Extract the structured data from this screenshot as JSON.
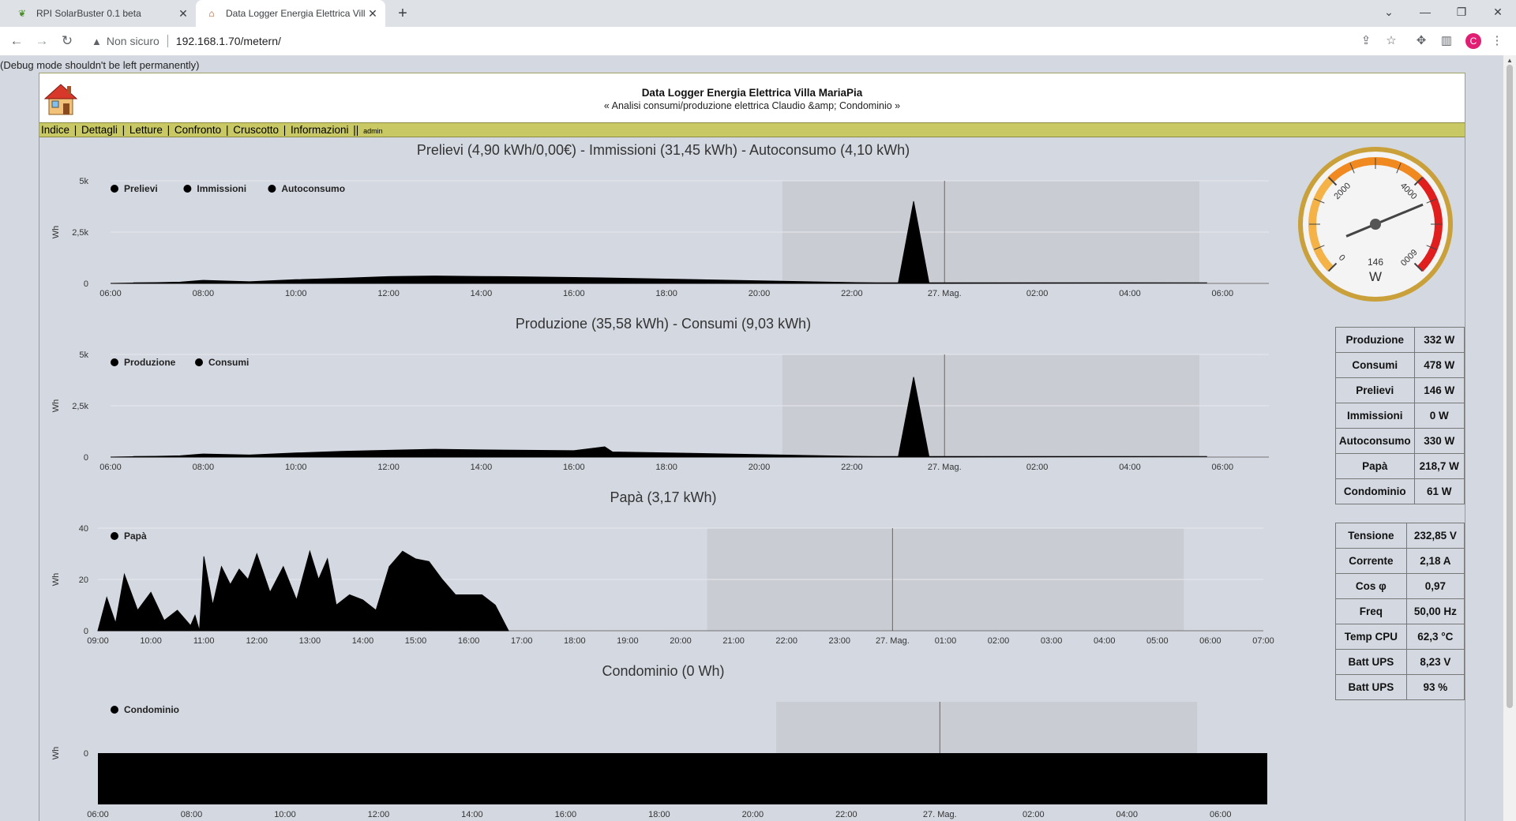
{
  "browser": {
    "tabs": [
      {
        "title": "RPI SolarBuster 0.1 beta",
        "active": false
      },
      {
        "title": "Data Logger Energia Elettrica Vill",
        "active": true
      }
    ],
    "security_label": "Non sicuro",
    "url": "192.168.1.70/metern/",
    "profile_initial": "C"
  },
  "debug_message": "(Debug mode shouldn't be left permanently)",
  "site": {
    "title": "Data Logger Energia Elettrica Villa MariaPia",
    "subtitle": "« Analisi consumi/produzione elettrica Claudio &amp; Condominio »"
  },
  "menu": {
    "items": [
      "Indice",
      "Dettagli",
      "Letture",
      "Confronto",
      "Cruscotto",
      "Informazioni"
    ],
    "user": "admin"
  },
  "chart_data": [
    {
      "type": "area",
      "title": "Prelievi (4,90 kWh/0,00€) - Immissioni (31,45 kWh) - Autoconsumo (4,10 kWh)",
      "ylabel": "Wh",
      "ylim": [
        0,
        5000
      ],
      "yticks": [
        "0",
        "2,5k",
        "5k"
      ],
      "xticks": [
        "06:00",
        "08:00",
        "10:00",
        "12:00",
        "14:00",
        "16:00",
        "18:00",
        "20:00",
        "22:00",
        "27. Mag.",
        "02:00",
        "04:00",
        "06:00"
      ],
      "legend": [
        "Prelievi",
        "Immissioni",
        "Autoconsumo"
      ],
      "x": [
        "06:00",
        "07:00",
        "07:30",
        "08:00",
        "09:00",
        "10:00",
        "11:00",
        "12:00",
        "13:00",
        "14:00",
        "15:00",
        "16:00",
        "16:50",
        "23:00",
        "23:20",
        "23:40",
        "05:40",
        "06:30"
      ],
      "values": [
        0,
        40,
        60,
        150,
        80,
        180,
        250,
        330,
        360,
        340,
        320,
        290,
        260,
        0,
        4000,
        0,
        30,
        30
      ]
    },
    {
      "type": "area",
      "title": "Produzione (35,58 kWh) - Consumi (9,03 kWh)",
      "ylabel": "Wh",
      "ylim": [
        0,
        5000
      ],
      "yticks": [
        "0",
        "2,5k",
        "5k"
      ],
      "xticks": [
        "06:00",
        "08:00",
        "10:00",
        "12:00",
        "14:00",
        "16:00",
        "18:00",
        "20:00",
        "22:00",
        "27. Mag.",
        "02:00",
        "04:00",
        "06:00"
      ],
      "legend": [
        "Produzione",
        "Consumi"
      ],
      "x": [
        "06:00",
        "07:00",
        "07:30",
        "08:00",
        "09:00",
        "10:00",
        "11:00",
        "12:00",
        "13:00",
        "14:00",
        "15:00",
        "16:00",
        "16:40",
        "16:50",
        "23:00",
        "23:20",
        "23:40",
        "05:40",
        "06:30"
      ],
      "values": [
        0,
        40,
        60,
        150,
        100,
        200,
        280,
        330,
        380,
        350,
        330,
        310,
        500,
        250,
        0,
        3900,
        0,
        30,
        30
      ]
    },
    {
      "type": "area",
      "title": "Papà (3,17 kWh)",
      "ylabel": "Wh",
      "ylim": [
        0,
        40
      ],
      "yticks": [
        "0",
        "20",
        "40"
      ],
      "xticks": [
        "09:00",
        "10:00",
        "11:00",
        "12:00",
        "13:00",
        "14:00",
        "15:00",
        "16:00",
        "17:00",
        "18:00",
        "19:00",
        "20:00",
        "21:00",
        "22:00",
        "23:00",
        "27. Mag.",
        "01:00",
        "02:00",
        "03:00",
        "04:00",
        "05:00",
        "06:00",
        "07:00"
      ],
      "legend": [
        "Papà"
      ],
      "x": [
        "09:00",
        "09:10",
        "09:20",
        "09:30",
        "09:45",
        "10:00",
        "10:15",
        "10:30",
        "10:45",
        "10:50",
        "10:55",
        "11:00",
        "11:10",
        "11:20",
        "11:30",
        "11:40",
        "11:50",
        "12:00",
        "12:15",
        "12:30",
        "12:45",
        "13:00",
        "13:10",
        "13:20",
        "13:30",
        "13:45",
        "14:00",
        "14:15",
        "14:30",
        "14:45",
        "15:00",
        "15:15",
        "15:30",
        "15:45",
        "16:00",
        "16:15",
        "16:30",
        "16:45"
      ],
      "values": [
        0,
        13,
        3,
        22,
        8,
        15,
        4,
        8,
        2,
        6,
        0,
        29,
        10,
        25,
        18,
        24,
        20,
        30,
        15,
        25,
        12,
        31,
        20,
        28,
        10,
        14,
        12,
        8,
        25,
        31,
        28,
        27,
        20,
        14,
        14,
        14,
        10,
        0
      ]
    },
    {
      "type": "area",
      "title": "Condominio (0 Wh)",
      "ylabel": "Wh",
      "yticks": [
        "0"
      ],
      "xticks": [
        "06:00",
        "08:00",
        "10:00",
        "12:00",
        "14:00",
        "16:00",
        "18:00",
        "20:00",
        "22:00",
        "27. Mag.",
        "02:00",
        "04:00",
        "06:00"
      ],
      "legend": [
        "Condominio"
      ],
      "x": [
        "06:00",
        "06:00"
      ],
      "values": [
        0,
        0
      ]
    }
  ],
  "gauge": {
    "value": 146,
    "unit": "W",
    "labels": [
      "0",
      "2000",
      "4000",
      "6000"
    ],
    "max": 6000
  },
  "readings": [
    {
      "label": "Produzione",
      "value": "332 W"
    },
    {
      "label": "Consumi",
      "value": "478 W"
    },
    {
      "label": "Prelievi",
      "value": "146 W"
    },
    {
      "label": "Immissioni",
      "value": "0 W"
    },
    {
      "label": "Autoconsumo",
      "value": "330 W"
    },
    {
      "label": "Papà",
      "value": "218,7 W"
    },
    {
      "label": "Condominio",
      "value": "61 W"
    }
  ],
  "system": [
    {
      "label": "Tensione",
      "value": "232,85 V"
    },
    {
      "label": "Corrente",
      "value": "2,18 A"
    },
    {
      "label": "Cos φ",
      "value": "0,97"
    },
    {
      "label": "Freq",
      "value": "50,00 Hz"
    },
    {
      "label": "Temp CPU",
      "value": "62,3 °C"
    },
    {
      "label": "Batt UPS",
      "value": "8,23 V"
    },
    {
      "label": "Batt UPS",
      "value": "93 %"
    }
  ],
  "colors": {
    "menu_bar": "#c8c864",
    "plot_band": "#c9ccd3",
    "series": "#000000",
    "gauge_red": "#e01e1e",
    "gauge_orange": "#f08a20"
  }
}
